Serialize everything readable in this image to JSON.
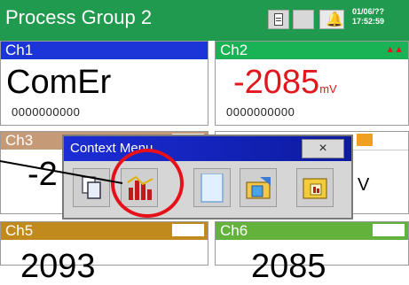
{
  "header": {
    "title": "Process Group 2",
    "date": "01/06/??",
    "time": "17:52:59",
    "icons": [
      "document-icon",
      "blank-icon",
      "alarm-bell-icon"
    ]
  },
  "tiles": [
    {
      "name": "Ch1",
      "value": "ComEr",
      "unit": "",
      "counter": "0000000000",
      "color": "#1b35d6"
    },
    {
      "name": "Ch2",
      "value": "-2085",
      "unit": "mV",
      "counter": "0000000000",
      "color": "#19b255"
    },
    {
      "name": "Ch3",
      "value": "-2",
      "unit": "",
      "counter": "",
      "color": "#c59a76"
    },
    {
      "name": "",
      "value": "",
      "unit": "V",
      "counter": "",
      "color": "#ffffff"
    },
    {
      "name": "Ch5",
      "value": "2093",
      "unit": "",
      "counter": "",
      "color": "#c18a1d"
    },
    {
      "name": "Ch6",
      "value": "2085",
      "unit": "",
      "counter": "",
      "color": "#62b23c"
    }
  ],
  "context_menu": {
    "title": "Context Menu",
    "close_label": "×",
    "buttons": [
      "copy-icon",
      "bar-chart-icon",
      "blank-page-icon",
      "folder-icon",
      "summary-icon"
    ],
    "highlighted": "bar-chart-icon"
  }
}
